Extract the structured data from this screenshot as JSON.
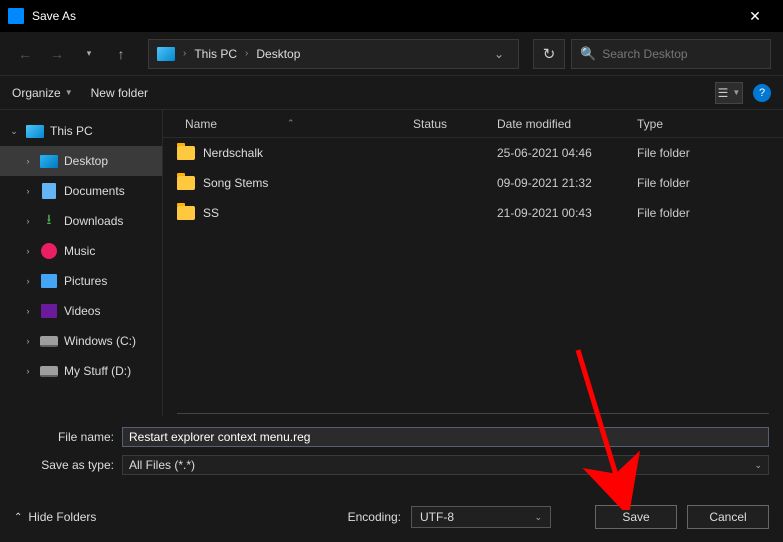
{
  "titlebar": {
    "title": "Save As"
  },
  "nav": {
    "crumb1": "This PC",
    "crumb2": "Desktop"
  },
  "search": {
    "placeholder": "Search Desktop"
  },
  "toolbar": {
    "organize": "Organize",
    "newfolder": "New folder"
  },
  "sidebar": [
    {
      "label": "This PC",
      "icon": "pc",
      "caret": "v",
      "indent": 0,
      "selected": false
    },
    {
      "label": "Desktop",
      "icon": "desktop",
      "caret": ">",
      "indent": 1,
      "selected": true
    },
    {
      "label": "Documents",
      "icon": "doc",
      "caret": ">",
      "indent": 1,
      "selected": false
    },
    {
      "label": "Downloads",
      "icon": "down",
      "caret": ">",
      "indent": 1,
      "selected": false
    },
    {
      "label": "Music",
      "icon": "music",
      "caret": ">",
      "indent": 1,
      "selected": false
    },
    {
      "label": "Pictures",
      "icon": "pic",
      "caret": ">",
      "indent": 1,
      "selected": false
    },
    {
      "label": "Videos",
      "icon": "video",
      "caret": ">",
      "indent": 1,
      "selected": false
    },
    {
      "label": "Windows (C:)",
      "icon": "drive",
      "caret": ">",
      "indent": 1,
      "selected": false
    },
    {
      "label": "My Stuff (D:)",
      "icon": "drive",
      "caret": ">",
      "indent": 1,
      "selected": false
    }
  ],
  "columns": {
    "name": "Name",
    "status": "Status",
    "date": "Date modified",
    "type": "Type"
  },
  "rows": [
    {
      "name": "Nerdschalk",
      "date": "25-06-2021 04:46",
      "type": "File folder"
    },
    {
      "name": "Song Stems",
      "date": "09-09-2021 21:32",
      "type": "File folder"
    },
    {
      "name": "SS",
      "date": "21-09-2021 00:43",
      "type": "File folder"
    }
  ],
  "fields": {
    "filename_label": "File name:",
    "filename_value": "Restart explorer context menu.reg",
    "saveas_label": "Save as type:",
    "saveas_value": "All Files  (*.*)",
    "encoding_label": "Encoding:",
    "encoding_value": "UTF-8"
  },
  "footer": {
    "hide": "Hide Folders",
    "save": "Save",
    "cancel": "Cancel"
  }
}
